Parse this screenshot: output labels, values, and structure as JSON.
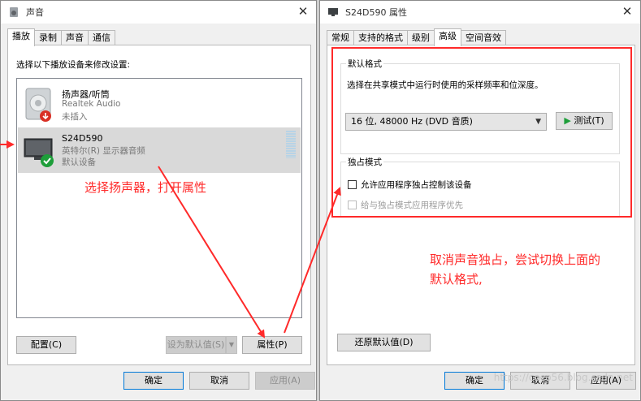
{
  "left_window": {
    "title": "声音",
    "tabs": [
      "播放",
      "录制",
      "声音",
      "通信"
    ],
    "active_tab": 0,
    "instruction": "选择以下播放设备来修改设置:",
    "devices": [
      {
        "name": "扬声器/听筒",
        "sub": "Realtek Audio",
        "status": "未插入"
      },
      {
        "name": "S24D590",
        "sub": "英特尔(R) 显示器音频",
        "status": "默认设备"
      }
    ],
    "buttons": {
      "configure": "配置(C)",
      "set_default": "设为默认值(S)",
      "properties": "属性(P)"
    },
    "footer": {
      "ok": "确定",
      "cancel": "取消",
      "apply": "应用(A)"
    }
  },
  "right_window": {
    "title": "S24D590 属性",
    "tabs": [
      "常规",
      "支持的格式",
      "级别",
      "高级",
      "空间音效"
    ],
    "active_tab": 3,
    "default_format": {
      "group_title": "默认格式",
      "description": "选择在共享模式中运行时使用的采样频率和位深度。",
      "selected": "16 位, 48000 Hz (DVD 音质)",
      "test_button": "测试(T)"
    },
    "exclusive": {
      "group_title": "独占模式",
      "allow": "允许应用程序独占控制该设备",
      "priority": "给与独占模式应用程序优先"
    },
    "restore_button": "还原默认值(D)",
    "footer": {
      "ok": "确定",
      "cancel": "取消",
      "apply": "应用(A)"
    }
  },
  "annotations": {
    "left": "选择扬声器，打开属性",
    "right_line1": "取消声音独占，尝试切换上面的",
    "right_line2": "默认格式,"
  },
  "watermark": "https://coco56.blog.csdn.net",
  "colors": {
    "annotation_red": "#ff2a2a",
    "accent_blue": "#0078d7",
    "selection_gray": "#d9d9d9",
    "check_green": "#1e9e3a"
  }
}
